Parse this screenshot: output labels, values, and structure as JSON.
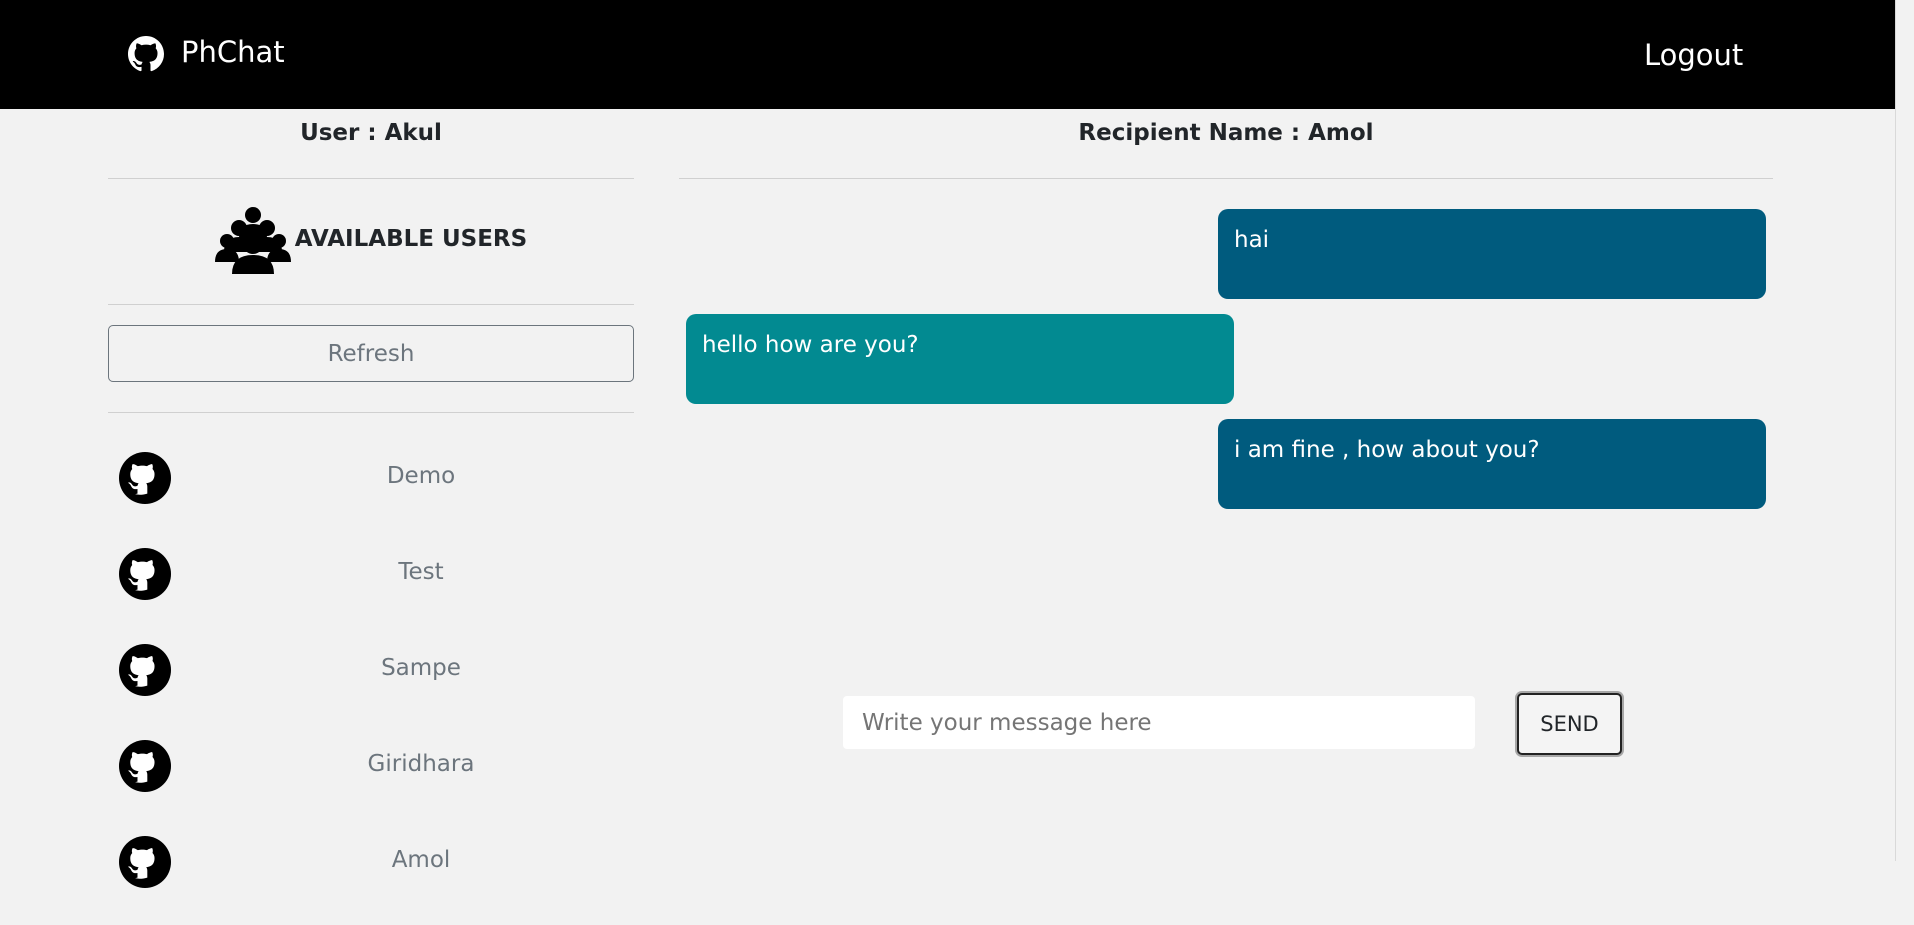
{
  "nav": {
    "brand": "PhChat",
    "logout": "Logout"
  },
  "sidebar": {
    "user_title": "User : Akul",
    "available_label": "AVAILABLE USERS",
    "refresh_label": "Refresh",
    "users": [
      "Demo",
      "Test",
      "Sampe",
      "Giridhara",
      "Amol"
    ]
  },
  "chat": {
    "recipient_title": "Recipient Name : Amol",
    "messages": [
      {
        "text": "hai",
        "direction": "sent"
      },
      {
        "text": "hello how are you?",
        "direction": "received"
      },
      {
        "text": "i am fine , how about you?",
        "direction": "sent"
      }
    ],
    "input_placeholder": "Write your message here",
    "input_value": "",
    "send_label": "SEND"
  },
  "colors": {
    "navbar": "#000000",
    "page_background": "#f2f2f2",
    "sent_bubble": "#005b7e",
    "received_bubble": "#028a91",
    "muted_text": "#6c757d"
  },
  "icons": {
    "brand": "github-icon",
    "user_avatar": "github-icon",
    "available_users": "users-group-icon"
  }
}
